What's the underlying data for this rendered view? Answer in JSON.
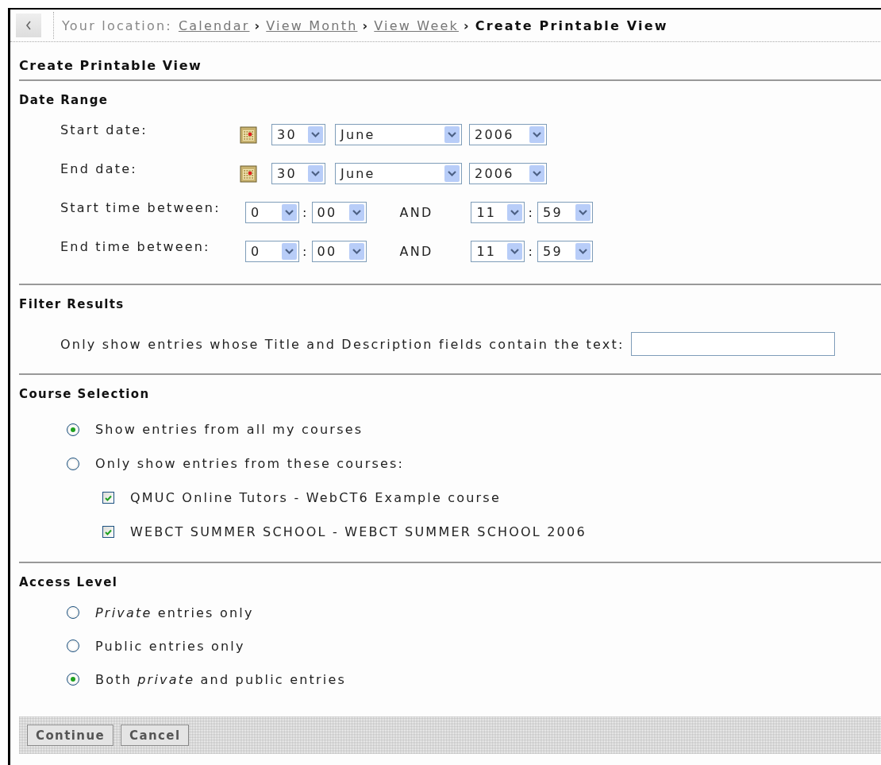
{
  "breadcrumb": {
    "label": "Your location:",
    "separator": "›",
    "links": [
      "Calendar",
      "View Month",
      "View Week"
    ],
    "current": "Create Printable View"
  },
  "title": "Create Printable View",
  "date_range": {
    "heading": "Date Range",
    "rows": [
      {
        "kind": "date",
        "label": "Start date:",
        "day": "30",
        "month": "June",
        "year": "2006"
      },
      {
        "kind": "date",
        "label": "End date:",
        "day": "30",
        "month": "June",
        "year": "2006"
      },
      {
        "kind": "time",
        "label": "Start time between:",
        "from_hour": "0",
        "from_minute": "00",
        "separator": ":",
        "joiner": "AND",
        "to_hour": "11",
        "to_minute": "59"
      },
      {
        "kind": "time",
        "label": "End time between:",
        "from_hour": "0",
        "from_minute": "00",
        "separator": ":",
        "joiner": "AND",
        "to_hour": "11",
        "to_minute": "59"
      }
    ]
  },
  "filter_results": {
    "heading": "Filter Results",
    "label": "Only show entries whose Title and Description fields contain the text:"
  },
  "course_selection": {
    "heading": "Course Selection",
    "options": [
      {
        "label": "Show entries from all my courses",
        "selected": true
      },
      {
        "label": "Only show entries from these courses:",
        "selected": false
      }
    ],
    "courses": [
      {
        "label": "QMUC Online Tutors - WebCT6 Example course",
        "checked": true
      },
      {
        "label": "WEBCT SUMMER SCHOOL - WEBCT SUMMER SCHOOL 2006",
        "checked": true
      }
    ]
  },
  "access_level": {
    "heading": "Access Level",
    "options": [
      {
        "label": "*Private* entries only",
        "selected": false
      },
      {
        "label": "Public entries only",
        "selected": false
      },
      {
        "label": "Both *private* and public entries",
        "selected": true
      }
    ]
  },
  "buttons": [
    "Continue",
    "Cancel"
  ]
}
